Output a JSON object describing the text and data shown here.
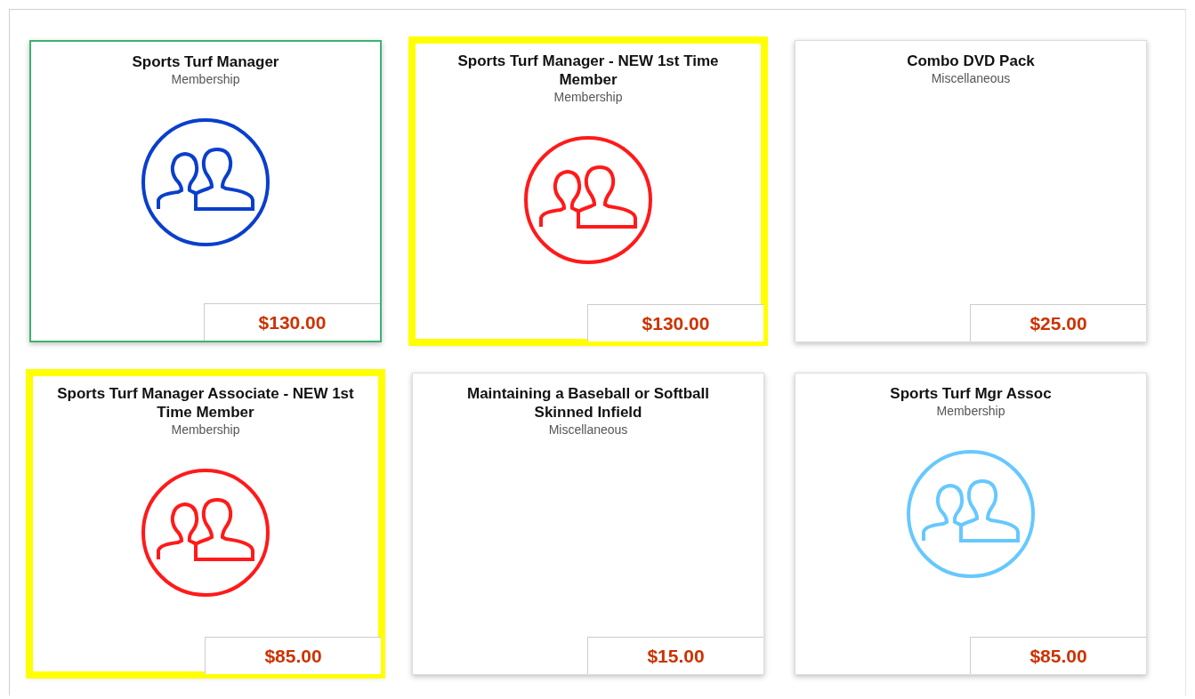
{
  "products": [
    {
      "title": "Sports Turf Manager",
      "category": "Membership",
      "price": "$130.00",
      "color": "#0a3fcc",
      "selected": true,
      "highlighted": false
    },
    {
      "title": "Sports Turf Manager - NEW 1st Time Member",
      "category": "Membership",
      "price": "$130.00",
      "color": "#ff1a1a",
      "selected": false,
      "highlighted": true
    },
    {
      "title": "Combo DVD Pack",
      "category": "Miscellaneous",
      "price": "$25.00",
      "selected": false,
      "highlighted": false
    },
    {
      "title": "Sports Turf Manager Associate - NEW 1st Time Member",
      "category": "Membership",
      "price": "$85.00",
      "color": "#ff1a1a",
      "selected": false,
      "highlighted": true
    },
    {
      "title": "Maintaining a Baseball or Softball Skinned Infield",
      "category": "Miscellaneous",
      "price": "$15.00",
      "selected": false,
      "highlighted": false
    },
    {
      "title": "Sports Turf Mgr Assoc",
      "category": "Membership",
      "price": "$85.00",
      "color": "#66c8ff",
      "selected": false,
      "highlighted": false
    }
  ]
}
